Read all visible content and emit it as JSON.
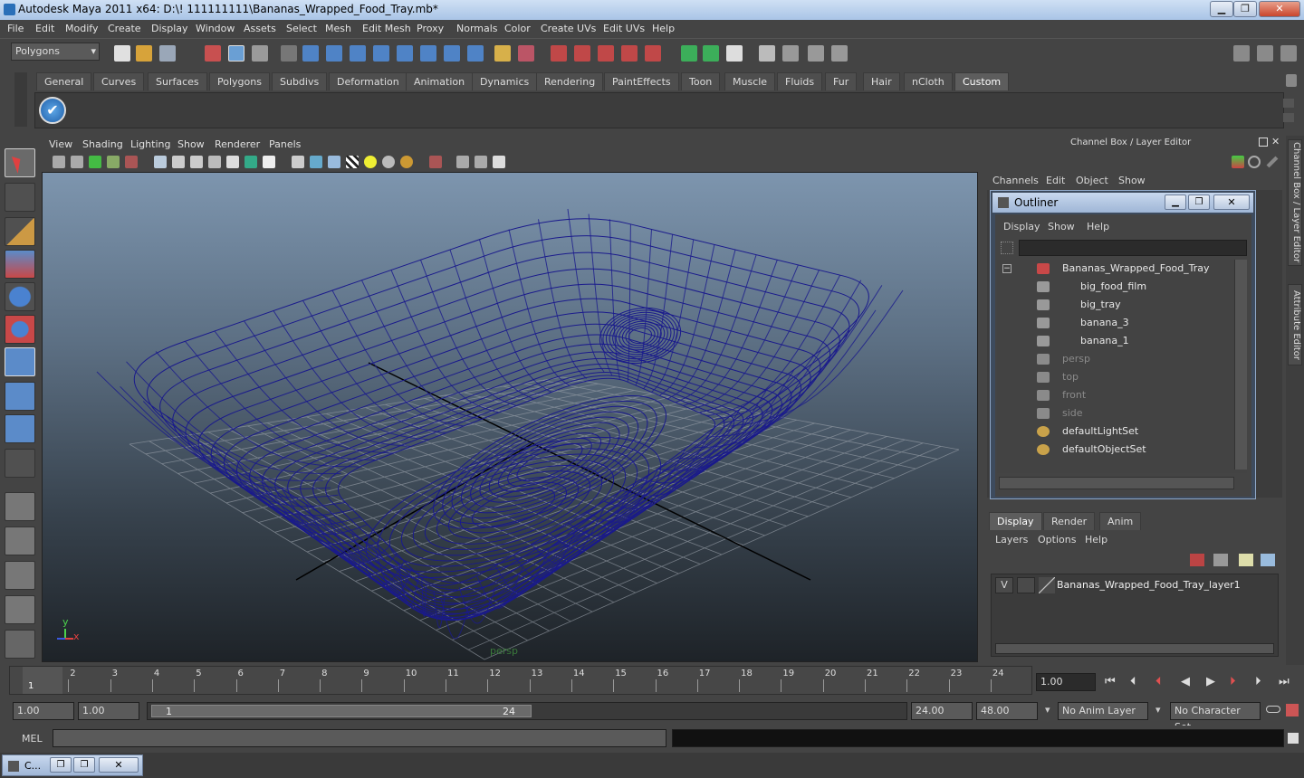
{
  "window": {
    "title": "Autodesk Maya 2011 x64: D:\\! 111111111\\Bananas_Wrapped_Food_Tray.mb*",
    "min": "▁",
    "max": "❐",
    "close": "✕"
  },
  "menubar": [
    "File",
    "Edit",
    "Modify",
    "Create",
    "Display",
    "Window",
    "Assets",
    "Select",
    "Mesh",
    "Edit Mesh",
    "Proxy",
    "Normals",
    "Color",
    "Create UVs",
    "Edit UVs",
    "Help"
  ],
  "status": {
    "mode": "Polygons"
  },
  "shelf_tabs": [
    "General",
    "Curves",
    "Surfaces",
    "Polygons",
    "Subdivs",
    "Deformation",
    "Animation",
    "Dynamics",
    "Rendering",
    "PaintEffects",
    "Toon",
    "Muscle",
    "Fluids",
    "Fur",
    "Hair",
    "nCloth",
    "Custom"
  ],
  "shelf_active": "Custom",
  "panel_menu": [
    "View",
    "Shading",
    "Lighting",
    "Show",
    "Renderer",
    "Panels"
  ],
  "viewport": {
    "camera": "persp",
    "axis_x": "x",
    "axis_y": "y",
    "mesh_color": "#1a1a8c"
  },
  "channel_box": {
    "title": "Channel Box / Layer Editor",
    "menu": [
      "Channels",
      "Edit",
      "Object",
      "Show"
    ]
  },
  "outliner": {
    "title": "Outliner",
    "menu": [
      "Display",
      "Show",
      "Help"
    ],
    "items": [
      {
        "label": "Bananas_Wrapped_Food_Tray",
        "dim": false
      },
      {
        "label": "big_food_film",
        "dim": false
      },
      {
        "label": "big_tray",
        "dim": false
      },
      {
        "label": "banana_3",
        "dim": false
      },
      {
        "label": "banana_1",
        "dim": false
      },
      {
        "label": "persp",
        "dim": true
      },
      {
        "label": "top",
        "dim": true
      },
      {
        "label": "front",
        "dim": true
      },
      {
        "label": "side",
        "dim": true
      },
      {
        "label": "defaultLightSet",
        "dim": false
      },
      {
        "label": "defaultObjectSet",
        "dim": false
      }
    ]
  },
  "layer_editor": {
    "tabs": [
      "Display",
      "Render",
      "Anim"
    ],
    "menu": [
      "Layers",
      "Options",
      "Help"
    ],
    "layer": {
      "visible": "V",
      "name": "Bananas_Wrapped_Food_Tray_layer1"
    }
  },
  "side_tabs": [
    "Channel Box / Layer Editor",
    "Attribute Editor"
  ],
  "timeline": {
    "ticks": [
      "1",
      "2",
      "3",
      "4",
      "5",
      "6",
      "7",
      "8",
      "9",
      "10",
      "11",
      "12",
      "13",
      "14",
      "15",
      "16",
      "17",
      "18",
      "19",
      "20",
      "21",
      "22",
      "23",
      "24"
    ],
    "current": "1",
    "current_frame": "1.00"
  },
  "range": {
    "start": "1.00",
    "start2": "1.00",
    "slider_start": "1",
    "slider_end": "24",
    "end": "24.00",
    "end2": "48.00",
    "anim_layer": "No Anim Layer",
    "char_set": "No Character Set"
  },
  "cmd": {
    "label": "MEL"
  },
  "taskbar": {
    "item": "C..."
  }
}
